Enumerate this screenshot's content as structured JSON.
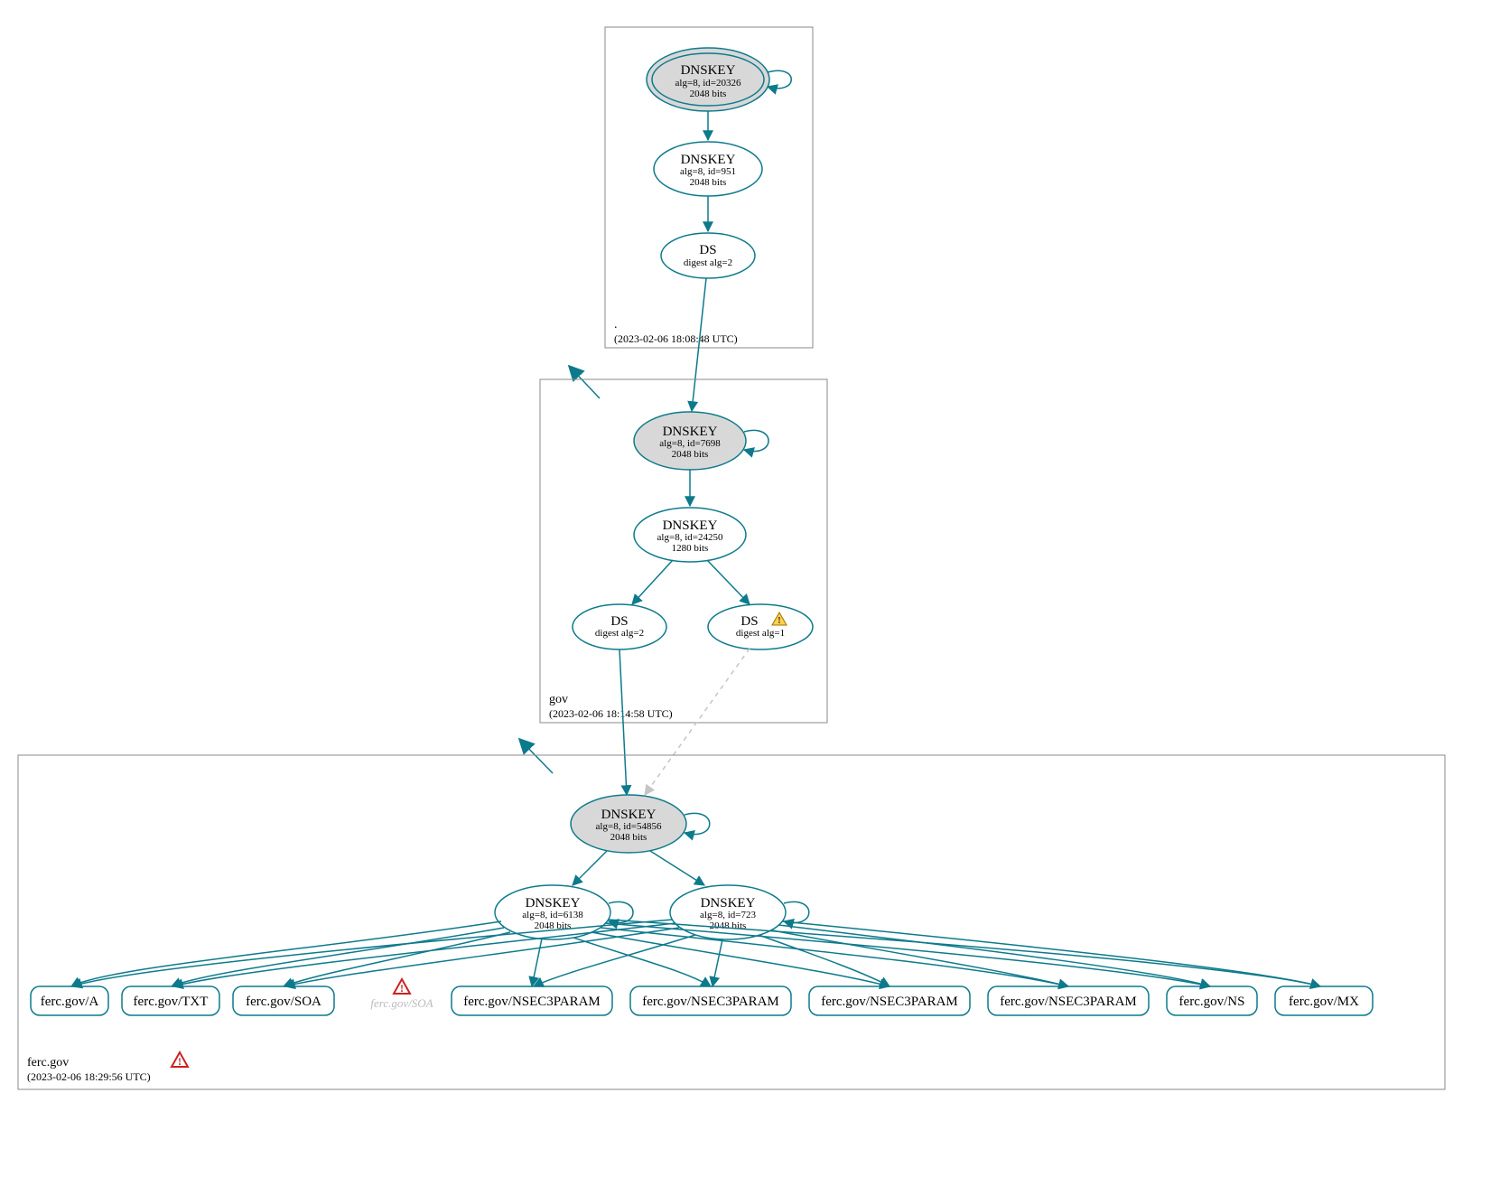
{
  "zones": {
    "root": {
      "name": ".",
      "timestamp": "(2023-02-06 18:08:48 UTC)"
    },
    "gov": {
      "name": "gov",
      "timestamp": "(2023-02-06 18:14:58 UTC)"
    },
    "fercgov": {
      "name": "ferc.gov",
      "timestamp": "(2023-02-06 18:29:56 UTC)"
    }
  },
  "nodes": {
    "root_ksk": {
      "title": "DNSKEY",
      "line2": "alg=8, id=20326",
      "line3": "2048 bits"
    },
    "root_zsk": {
      "title": "DNSKEY",
      "line2": "alg=8, id=951",
      "line3": "2048 bits"
    },
    "root_ds": {
      "title": "DS",
      "line2": "digest alg=2"
    },
    "gov_ksk": {
      "title": "DNSKEY",
      "line2": "alg=8, id=7698",
      "line3": "2048 bits"
    },
    "gov_zsk": {
      "title": "DNSKEY",
      "line2": "alg=8, id=24250",
      "line3": "1280 bits"
    },
    "gov_ds1": {
      "title": "DS",
      "line2": "digest alg=2"
    },
    "gov_ds2": {
      "title": "DS",
      "line2": "digest alg=1"
    },
    "ferc_ksk": {
      "title": "DNSKEY",
      "line2": "alg=8, id=54856",
      "line3": "2048 bits"
    },
    "ferc_zsk1": {
      "title": "DNSKEY",
      "line2": "alg=8, id=6138",
      "line3": "2048 bits"
    },
    "ferc_zsk2": {
      "title": "DNSKEY",
      "line2": "alg=8, id=723",
      "line3": "2048 bits"
    }
  },
  "rrsets": {
    "a": "ferc.gov/A",
    "txt": "ferc.gov/TXT",
    "soa": "ferc.gov/SOA",
    "soa2": "ferc.gov/SOA",
    "n3p1": "ferc.gov/NSEC3PARAM",
    "n3p2": "ferc.gov/NSEC3PARAM",
    "n3p3": "ferc.gov/NSEC3PARAM",
    "n3p4": "ferc.gov/NSEC3PARAM",
    "ns": "ferc.gov/NS",
    "mx": "ferc.gov/MX"
  }
}
